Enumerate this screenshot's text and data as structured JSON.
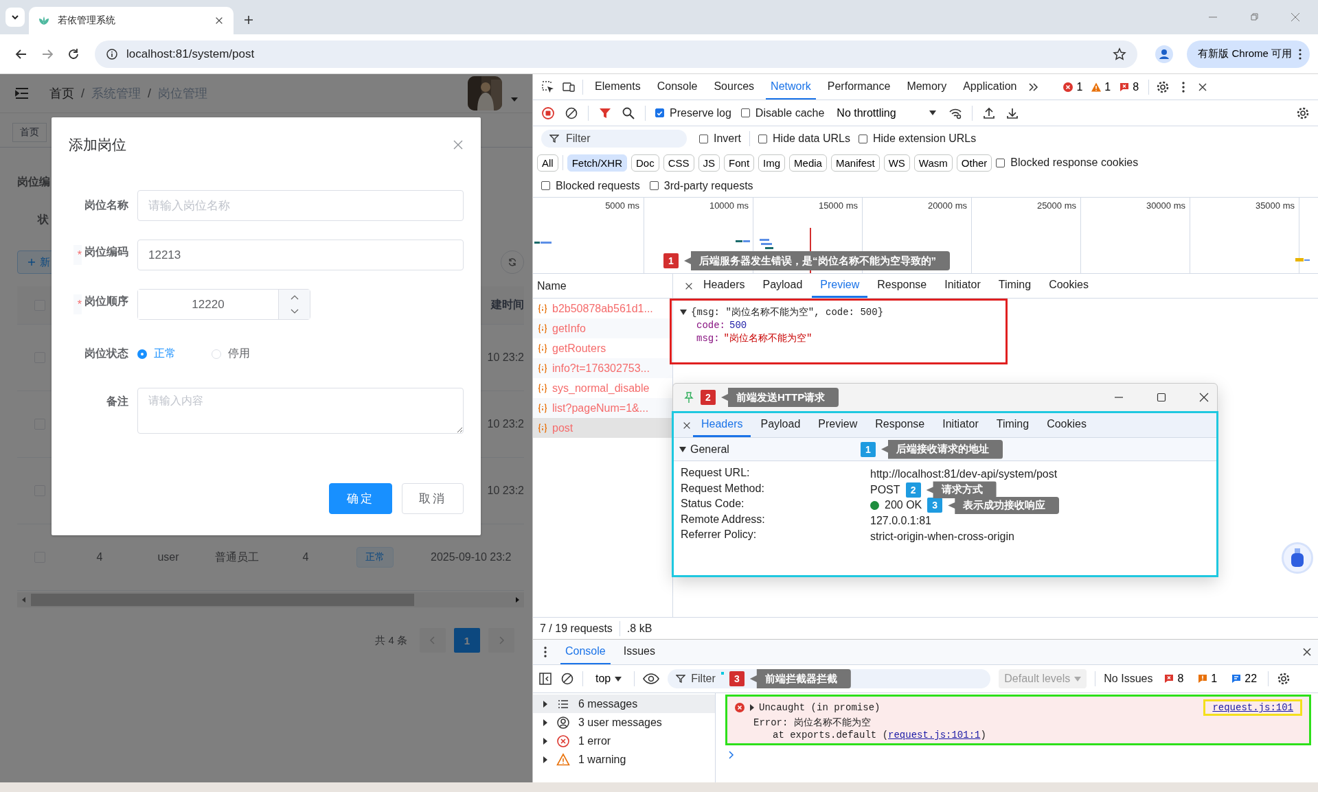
{
  "browser": {
    "tab_title": "若依管理系统",
    "url": "localhost:81/system/post",
    "update_button": "有新版 Chrome 可用"
  },
  "app": {
    "breadcrumb": [
      "首页",
      "系统管理",
      "岗位管理"
    ],
    "breadcrumb_separator": "/",
    "tags": [
      "首页"
    ],
    "search_label": "岗位编",
    "status_label": "状",
    "add_button": "新",
    "table": {
      "header": "建时间",
      "header_checked": false,
      "partial_rows": [
        {
          "date": "10 23:2",
          "checked": false
        },
        {
          "date": "10 23:2",
          "checked": false
        },
        {
          "date": "10 23:2",
          "checked": false
        }
      ],
      "last_row": {
        "checked": false,
        "cells": [
          "4",
          "user",
          "普通员工",
          "4"
        ],
        "status": "正常",
        "created": "2025-09-10 23:2"
      }
    },
    "pagination": {
      "total": "共 4 条",
      "pages": [
        {
          "label": "1",
          "selected": true
        }
      ]
    }
  },
  "dialog": {
    "title": "添加岗位",
    "required_mark": "*",
    "fields": [
      {
        "kind": "text",
        "label": "岗位名称",
        "required": false,
        "placeholder": "请输入岗位名称"
      },
      {
        "kind": "text",
        "label": "岗位编码",
        "required": true,
        "value": "12213"
      },
      {
        "kind": "number",
        "label": "岗位顺序",
        "required": true,
        "value": "12220"
      },
      {
        "kind": "radio",
        "label": "岗位状态",
        "required": false,
        "options": [
          {
            "label": "正常",
            "selected": true
          },
          {
            "label": "停用",
            "selected": false
          }
        ]
      },
      {
        "kind": "textarea",
        "label": "备注",
        "required": false,
        "placeholder": "请输入内容"
      }
    ],
    "buttons": [
      {
        "label": "确定",
        "primary": true
      },
      {
        "label": "取消",
        "primary": false
      }
    ]
  },
  "devtools": {
    "tabs": [
      {
        "label": "Elements",
        "selected": false
      },
      {
        "label": "Console",
        "selected": false
      },
      {
        "label": "Sources",
        "selected": false
      },
      {
        "label": "Network",
        "selected": true
      },
      {
        "label": "Performance",
        "selected": false
      },
      {
        "label": "Memory",
        "selected": false
      },
      {
        "label": "Application",
        "selected": false
      }
    ],
    "counts": [
      {
        "kind": "error",
        "count": "1"
      },
      {
        "kind": "warning",
        "count": "1"
      },
      {
        "kind": "issue_error",
        "count": "8"
      }
    ],
    "network": {
      "toolbar_checks": [
        {
          "label": "Preserve log",
          "checked": true
        },
        {
          "label": "Disable cache",
          "checked": false
        }
      ],
      "throttling": "No throttling",
      "filter": {
        "placeholder": "Filter"
      },
      "filter_checks": [
        {
          "label": "Invert",
          "checked": false
        },
        {
          "label": "Hide data URLs",
          "checked": false
        },
        {
          "label": "Hide extension URLs",
          "checked": false
        }
      ],
      "type_filters": [
        {
          "label": "All",
          "selected": false
        },
        {
          "label": "Fetch/XHR",
          "selected": true
        },
        {
          "label": "Doc",
          "selected": false
        },
        {
          "label": "CSS",
          "selected": false
        },
        {
          "label": "JS",
          "selected": false
        },
        {
          "label": "Font",
          "selected": false
        },
        {
          "label": "Img",
          "selected": false
        },
        {
          "label": "Media",
          "selected": false
        },
        {
          "label": "Manifest",
          "selected": false
        },
        {
          "label": "WS",
          "selected": false
        },
        {
          "label": "Wasm",
          "selected": false
        },
        {
          "label": "Other",
          "selected": false
        }
      ],
      "cookie_check": {
        "label": "Blocked response cookies",
        "checked": false
      },
      "more_checks": [
        {
          "label": "Blocked requests",
          "checked": false
        },
        {
          "label": "3rd-party requests",
          "checked": false
        }
      ],
      "timeline_ticks": [
        "5000 ms",
        "10000 ms",
        "15000 ms",
        "20000 ms",
        "25000 ms",
        "30000 ms",
        "35000 ms"
      ],
      "annotation": {
        "number": "1",
        "color": "#d32f2f",
        "text": "后端服务器发生错误，是“岗位名称不能为空导致的”"
      },
      "name_header": "Name",
      "requests": [
        {
          "name": "b2b50878ab561d1...",
          "selected": false
        },
        {
          "name": "getInfo",
          "selected": false
        },
        {
          "name": "getRouters",
          "selected": false
        },
        {
          "name": "info?t=176302753...",
          "selected": false
        },
        {
          "name": "sys_normal_disable",
          "selected": false
        },
        {
          "name": "list?pageNum=1&...",
          "selected": false
        },
        {
          "name": "post",
          "selected": true
        }
      ],
      "detail_tabs": [
        {
          "label": "Headers",
          "selected": false
        },
        {
          "label": "Payload",
          "selected": false
        },
        {
          "label": "Preview",
          "selected": true
        },
        {
          "label": "Response",
          "selected": false
        },
        {
          "label": "Initiator",
          "selected": false
        },
        {
          "label": "Timing",
          "selected": false
        },
        {
          "label": "Cookies",
          "selected": false
        }
      ],
      "preview": {
        "summary": "{msg: \"岗位名称不能为空\", code: 500}",
        "fields": [
          {
            "key": "code:",
            "value": "500",
            "kind": "number"
          },
          {
            "key": "msg:",
            "value": "\"岗位名称不能为空\"",
            "kind": "string"
          }
        ]
      },
      "status": [
        "7 / 19 requests",
        ".8 kB"
      ]
    },
    "floating_window": {
      "annotation": {
        "number": "2",
        "color": "#d32f2f",
        "text": "前端发送HTTP请求"
      },
      "tabs": [
        {
          "label": "Headers",
          "selected": true
        },
        {
          "label": "Payload",
          "selected": false
        },
        {
          "label": "Preview",
          "selected": false
        },
        {
          "label": "Response",
          "selected": false
        },
        {
          "label": "Initiator",
          "selected": false
        },
        {
          "label": "Timing",
          "selected": false
        },
        {
          "label": "Cookies",
          "selected": false
        }
      ],
      "section": "General",
      "section_annotation": {
        "number": "1",
        "color": "#1e9be0",
        "text": "后端接收请求的地址"
      },
      "rows": [
        {
          "label": "Request URL:",
          "value": "http://localhost:81/dev-api/system/post"
        },
        {
          "label": "Request Method:",
          "value": "POST",
          "annotation": {
            "number": "2",
            "color": "#1e9be0",
            "text": "请求方式"
          }
        },
        {
          "label": "Status Code:",
          "value": "200 OK",
          "status_dot": {
            "color": "#1e8e3e"
          },
          "annotation": {
            "number": "3",
            "color": "#1e9be0",
            "text": "表示成功接收响应"
          }
        },
        {
          "label": "Remote Address:",
          "value": "127.0.0.1:81"
        },
        {
          "label": "Referrer Policy:",
          "value": "strict-origin-when-cross-origin"
        }
      ]
    },
    "console": {
      "tabs": [
        {
          "label": "Console",
          "selected": true
        },
        {
          "label": "Issues",
          "selected": false
        }
      ],
      "context": "top",
      "filter": "Filter",
      "annotation": {
        "number": "3",
        "color": "#d32f2f",
        "text": "前端拦截器拦截"
      },
      "levels": "Default levels",
      "issues": "No Issues",
      "issue_counts": [
        {
          "kind": "issue_error",
          "count": "8"
        },
        {
          "kind": "issue_warning",
          "count": "1"
        },
        {
          "kind": "issue_info",
          "count": "22"
        }
      ],
      "sidebar": [
        {
          "kind": "messages",
          "label": "6 messages",
          "selected": true
        },
        {
          "kind": "user",
          "label": "3 user messages",
          "selected": false
        },
        {
          "kind": "error",
          "label": "1 error",
          "selected": false
        },
        {
          "kind": "warning",
          "label": "1 warning",
          "selected": false
        }
      ],
      "messages": [
        {
          "kind": "error",
          "head": "Uncaught (in promise)",
          "error": "Error: 岗位名称不能为空",
          "stack_prefix": "at exports.default (",
          "stack_link": "request.js:101:1",
          "stack_suffix": ")",
          "source": "request.js:101"
        }
      ]
    }
  }
}
